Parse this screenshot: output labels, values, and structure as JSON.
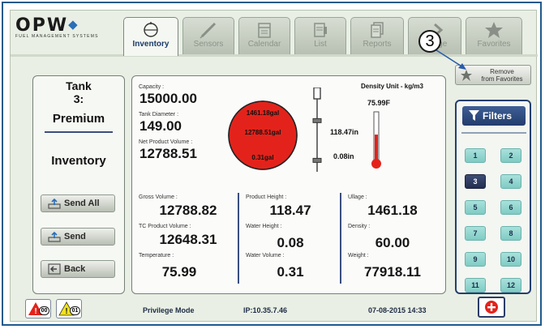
{
  "brand": {
    "name": "OPW",
    "tagline": "FUEL MANAGEMENT SYSTEMS"
  },
  "tabs": [
    {
      "label": "Inventory",
      "icon": "tank-icon",
      "active": true
    },
    {
      "label": "Sensors",
      "icon": "probe-icon",
      "active": false
    },
    {
      "label": "Calendar",
      "icon": "calendar-icon",
      "active": false
    },
    {
      "label": "List",
      "icon": "list-icon",
      "active": false
    },
    {
      "label": "Reports",
      "icon": "reports-icon",
      "active": false
    },
    {
      "label": "...ange",
      "icon": "change-icon",
      "active": false
    },
    {
      "label": "Favorites",
      "icon": "star-icon",
      "active": false
    }
  ],
  "callout": "3",
  "favorites_action": {
    "label_line1": "Remove",
    "label_line2": "from Favorites"
  },
  "left_panel": {
    "tank_line1": "Tank",
    "tank_line2": "3:",
    "product": "Premium",
    "mode": "Inventory",
    "buttons": {
      "send_all": "Send All",
      "send": "Send",
      "back": "Back"
    }
  },
  "tank_status": {
    "capacity_label": "Capacity :",
    "capacity_value": "15000.00",
    "diameter_label": "Tank Diameter :",
    "diameter_value": "149.00",
    "net_volume_label": "Net Product Volume :",
    "net_volume_value": "12788.51",
    "gauge_top": "1461.18gal",
    "gauge_mid": "12788.51gal",
    "gauge_bottom": "0.31gal",
    "density_unit": "Density Unit - kg/m3",
    "temperature_reading": "75.99F",
    "product_level": "118.47in",
    "water_level": "0.08in",
    "thermometer_fill": 0.55,
    "product_slider_fraction": 0.74,
    "water_slider_fraction": 0.1
  },
  "metrics": {
    "gross_volume_label": "Gross Volume :",
    "gross_volume_value": "12788.82",
    "tc_volume_label": "TC Product Volume :",
    "tc_volume_value": "12648.31",
    "temperature_label": "Temperature :",
    "temperature_value": "75.99",
    "product_height_label": "Product Height :",
    "product_height_value": "118.47",
    "water_height_label": "Water Height :",
    "water_height_value": "0.08",
    "water_volume_label": "Water Volume :",
    "water_volume_value": "0.31",
    "ullage_label": "Ullage :",
    "ullage_value": "1461.18",
    "density_label": "Density :",
    "density_value": "60.00",
    "weight_label": "Weight :",
    "weight_value": "77918.11"
  },
  "filters": {
    "label": "Filters",
    "tanks": [
      "1",
      "2",
      "3",
      "4",
      "5",
      "6",
      "7",
      "8",
      "9",
      "10",
      "11",
      "12"
    ],
    "selected": "3"
  },
  "footer": {
    "alarm_count": "00",
    "warning_count": "01",
    "privilege": "Privilege Mode",
    "ip": "IP:10.35.7.46",
    "datetime": "07-08-2015 14:33"
  },
  "colors": {
    "accent": "#223c6b",
    "tank_fill": "#e3231b",
    "filter_button": "#8fd3cc",
    "selected_filter": "#2b3859"
  }
}
